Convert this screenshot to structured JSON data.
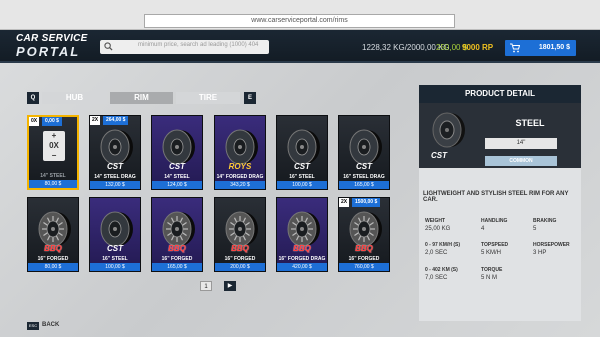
{
  "browser": {
    "url": "www.carserviceportal.com/rims"
  },
  "header": {
    "logo_line1": "CAR SERVICE",
    "logo_line2": "PORTAL",
    "search_placeholder": "minimum price, search ad leading   (1000) 404",
    "weight": "1228,32 KG/2000,00 KG",
    "money": "250,00 $",
    "rp": "9000 RP",
    "cart_total": "1801,50 $"
  },
  "tabs": {
    "prev_key": "Q",
    "next_key": "E",
    "items": [
      "HUB",
      "RIM",
      "TIRE"
    ],
    "active": "RIM"
  },
  "cards": [
    {
      "name": "14\" STEEL",
      "price": "80,00 $",
      "brand": "",
      "qty": "0X",
      "cost": "0,00 $",
      "selected": true,
      "purple": false,
      "dim": true,
      "plus": true
    },
    {
      "name": "14\" STEEL DRAG",
      "price": "132,00 $",
      "brand": "CST",
      "qty": "2X",
      "cost": "264,00 $",
      "selected": false,
      "purple": false
    },
    {
      "name": "14\" STEEL",
      "price": "124,00 $",
      "brand": "CST",
      "selected": false,
      "purple": true
    },
    {
      "name": "14\" FORGED DRAG",
      "price": "343,20 $",
      "brand": "ROYS",
      "selected": false,
      "purple": true
    },
    {
      "name": "16\" STEEL",
      "price": "100,00 $",
      "brand": "CST",
      "selected": false,
      "purple": false
    },
    {
      "name": "16\" STEEL DRAG",
      "price": "165,00 $",
      "brand": "CST",
      "selected": false,
      "purple": false
    },
    {
      "name": "16\" FORGED",
      "price": "80,00 $",
      "brand": "BBQ",
      "selected": false,
      "purple": false
    },
    {
      "name": "16\" STEEL",
      "price": "100,00 $",
      "brand": "CST",
      "selected": false,
      "purple": true
    },
    {
      "name": "16\" FORGED",
      "price": "165,00 $",
      "brand": "BBQ",
      "selected": false,
      "purple": true
    },
    {
      "name": "16\" FORGED",
      "price": "200,00 $",
      "brand": "BBQ",
      "selected": false,
      "purple": false
    },
    {
      "name": "16\" FORGED DRAG",
      "price": "420,00 $",
      "brand": "BBQ",
      "selected": false,
      "purple": true
    },
    {
      "name": "16\" FORGED",
      "price": "760,00 $",
      "brand": "BBQ",
      "qty": "2X",
      "cost": "1500,00 $",
      "selected": false,
      "purple": false
    }
  ],
  "pager": {
    "page": "1",
    "next": "▶"
  },
  "detail": {
    "header": "PRODUCT DETAIL",
    "name": "STEEL",
    "brand": "CST",
    "size": "14\"",
    "rarity": "COMMON",
    "description": "LIGHTWEIGHT AND STYLISH STEEL RIM FOR ANY CAR.",
    "stats": [
      {
        "label": "WEIGHT",
        "value": "25,00 KG"
      },
      {
        "label": "HANDLING",
        "value": "4"
      },
      {
        "label": "BRAKING",
        "value": "5"
      },
      {
        "label": "0 - 97 KM/H (S)",
        "value": "2,0 SEC"
      },
      {
        "label": "TOPSPEED",
        "value": "5 KM/H"
      },
      {
        "label": "HORSEPOWER",
        "value": "3 HP"
      },
      {
        "label": "0 - 402 KM (S)",
        "value": "7,0 SEC"
      },
      {
        "label": "TORQUE",
        "value": "5 N M"
      }
    ]
  },
  "footer": {
    "esc_key": "ESC",
    "back_label": "BACK"
  }
}
